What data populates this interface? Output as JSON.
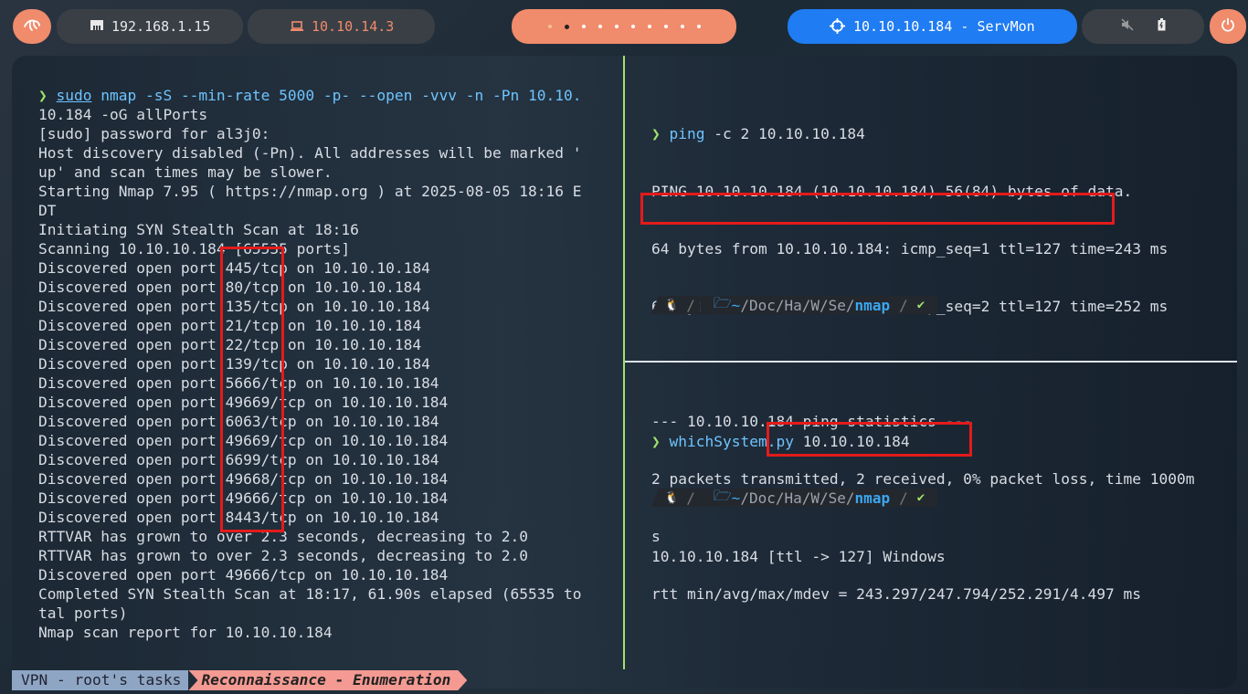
{
  "topbar": {
    "local_ip": "192.168.1.15",
    "vpn_ip": "10.10.14.3",
    "target": "10.10.10.184 - ServMon"
  },
  "left_pane": {
    "lines": [
      {
        "kind": "cmd"
      },
      "10.184 -oG allPorts",
      "[sudo] password for al3j0:",
      "Host discovery disabled (-Pn). All addresses will be marked '",
      "up' and scan times may be slower.",
      "Starting Nmap 7.95 ( https://nmap.org ) at 2025-08-05 18:16 E",
      "DT",
      "Initiating SYN Stealth Scan at 18:16",
      "Scanning 10.10.10.184 [65535 ports]",
      "Discovered open port 445/tcp on 10.10.10.184",
      "Discovered open port 80/tcp on 10.10.10.184",
      "Discovered open port 135/tcp on 10.10.10.184",
      "Discovered open port 21/tcp on 10.10.10.184",
      "Discovered open port 22/tcp on 10.10.10.184",
      "Discovered open port 139/tcp on 10.10.10.184",
      "Discovered open port 5666/tcp on 10.10.10.184",
      "Discovered open port 49669/tcp on 10.10.10.184",
      "Discovered open port 6063/tcp on 10.10.10.184",
      "Discovered open port 49669/tcp on 10.10.10.184",
      "Discovered open port 6699/tcp on 10.10.10.184",
      "Discovered open port 49668/tcp on 10.10.10.184",
      "Discovered open port 49666/tcp on 10.10.10.184",
      "Discovered open port 8443/tcp on 10.10.10.184",
      "RTTVAR has grown to over 2.3 seconds, decreasing to 2.0",
      "RTTVAR has grown to over 2.3 seconds, decreasing to 2.0",
      "Discovered open port 49666/tcp on 10.10.10.184",
      "Completed SYN Stealth Scan at 18:17, 61.90s elapsed (65535 to",
      "tal ports)",
      "Nmap scan report for 10.10.10.184"
    ],
    "cmd": {
      "arrow": "❯",
      "sudo": "sudo",
      "rest": " nmap -sS --min-rate 5000 -p- --open -vvv -n -Pn 10.10."
    }
  },
  "top_right_pane": {
    "cmd_arrow": "❯",
    "cmd_name": "ping",
    "cmd_args": " -c 2 10.10.10.184",
    "output": [
      "PING 10.10.10.184 (10.10.10.184) 56(84) bytes of data.",
      "64 bytes from 10.10.10.184: icmp_seq=1 ttl=127 time=243 ms",
      "64 bytes from 10.10.10.184: icmp_seq=2 ttl=127 time=252 ms",
      "",
      "--- 10.10.10.184 ping statistics ---",
      "2 packets transmitted, 2 received, 0% packet loss, time 1000m",
      "s",
      "rtt min/avg/max/mdev = 243.297/247.794/252.291/4.497 ms"
    ]
  },
  "bottom_right_pane": {
    "cmd_arrow": "❯",
    "cmd_name": "whichSystem.py",
    "cmd_args": " 10.10.10.184",
    "output_ip": "10.10.10.184",
    "output_rest": " [ttl -> 127] Windows"
  },
  "prompt": {
    "linux_glyph": "🐧",
    "home": "~",
    "path": "/Doc/Ha/W/Se/",
    "current": "nmap",
    "ok": "✔"
  },
  "statusbar": {
    "session": "VPN - root's tasks",
    "window": "Reconnaissance - Enumeration"
  }
}
